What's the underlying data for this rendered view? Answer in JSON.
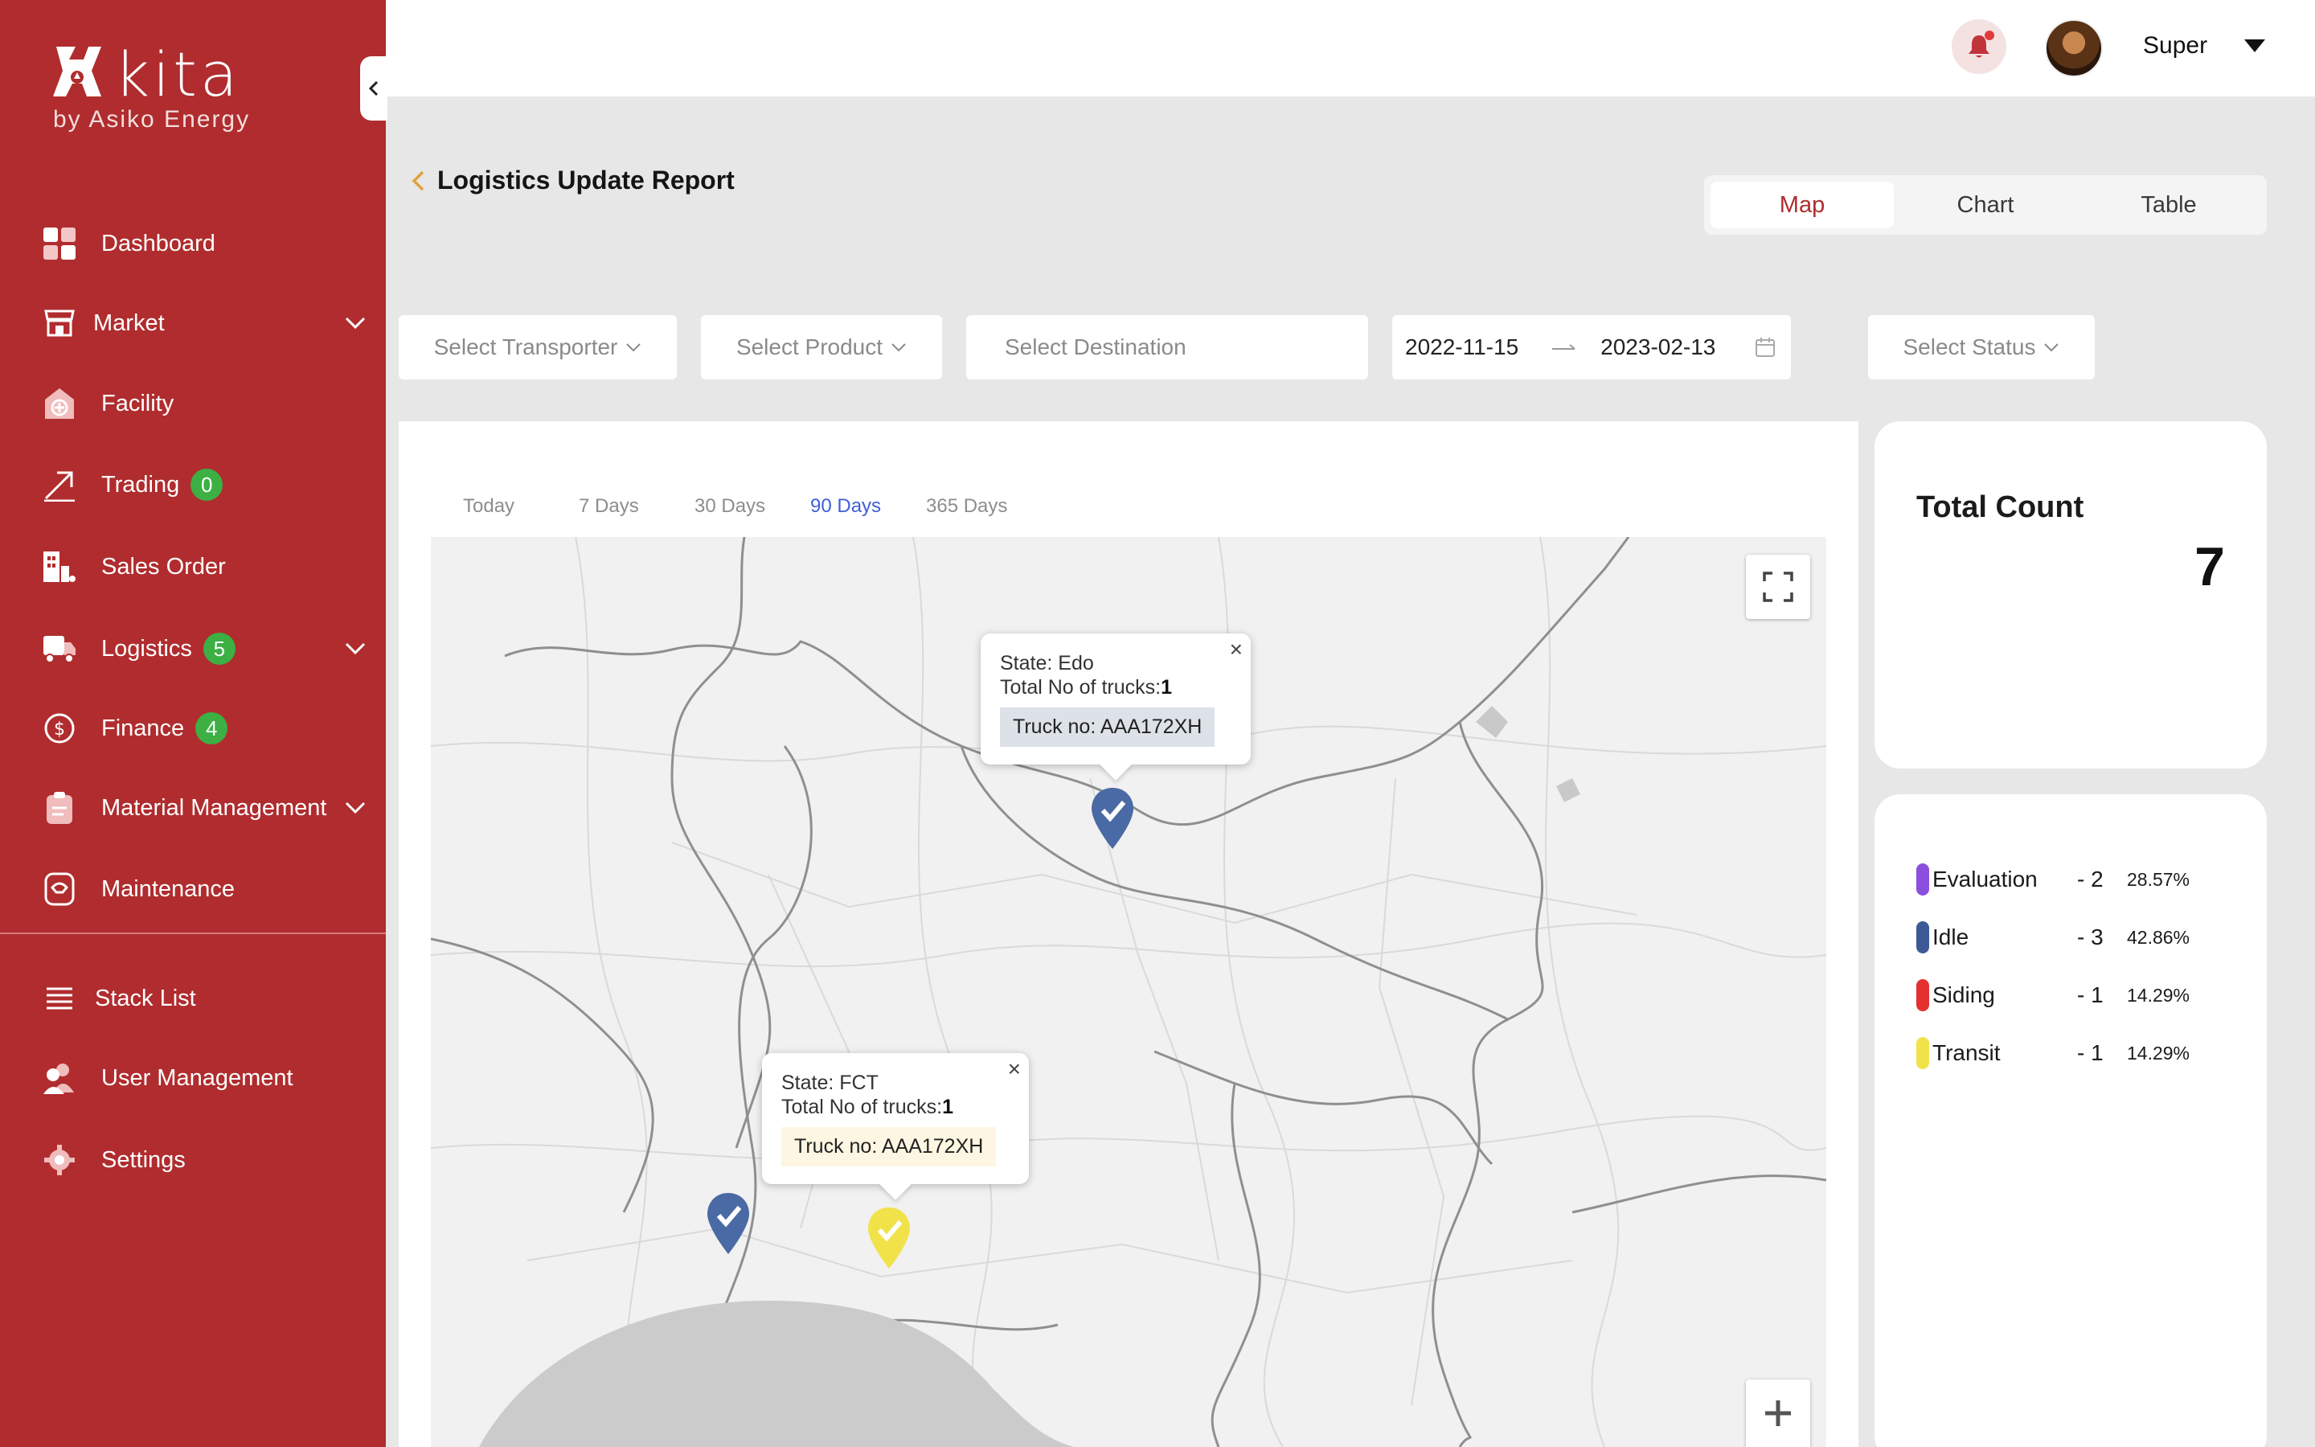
{
  "brand": {
    "name": "kita",
    "tagline": "by Asiko Energy"
  },
  "sidebar": {
    "items": [
      {
        "label": "Dashboard",
        "icon": "dashboard-icon"
      },
      {
        "label": "Market",
        "icon": "market-icon"
      },
      {
        "label": "Facility",
        "icon": "facility-icon"
      },
      {
        "label": "Trading",
        "icon": "trading-icon",
        "badge": "0"
      },
      {
        "label": "Sales Order",
        "icon": "sales-order-icon"
      },
      {
        "label": "Logistics",
        "icon": "truck-icon",
        "badge": "5"
      },
      {
        "label": "Finance",
        "icon": "dollar-icon",
        "badge": "4"
      },
      {
        "label": "Material Management",
        "icon": "clipboard-icon"
      },
      {
        "label": "Maintenance",
        "icon": "maintenance-icon"
      },
      {
        "label": "Stack List",
        "icon": "list-icon"
      },
      {
        "label": "User Management",
        "icon": "users-icon"
      },
      {
        "label": "Settings",
        "icon": "gear-icon"
      }
    ]
  },
  "topbar": {
    "user_name": "Super"
  },
  "header": {
    "title": "Logistics Update Report"
  },
  "view_tabs": [
    "Map",
    "Chart",
    "Table"
  ],
  "filters": {
    "transporter": "Select Transporter",
    "product": "Select Product",
    "destination": "Select Destination",
    "date_start": "2022-11-15",
    "date_end": "2023-02-13",
    "status": "Select Status"
  },
  "range_tabs": [
    "Today",
    "7 Days",
    "30 Days",
    "90 Days",
    "365 Days"
  ],
  "range_selected": "90 Days",
  "map": {
    "popups": [
      {
        "state": "State: Edo",
        "trucks_label": "Total No of trucks:",
        "trucks_value": "1",
        "truck_no": "Truck no: AAA172XH"
      },
      {
        "state": "State: FCT",
        "trucks_label": "Total No of trucks:",
        "trucks_value": "1",
        "truck_no": "Truck no: AAA172XH"
      }
    ],
    "close_glyph": "×",
    "zoom_in": "+"
  },
  "summary": {
    "title": "Total Count",
    "value": "7"
  },
  "legend": [
    {
      "name": "Evaluation",
      "count": "- 2",
      "percent": "28.57%",
      "color": "#8b4fe0"
    },
    {
      "name": "Idle",
      "count": "- 3",
      "percent": "42.86%",
      "color": "#3d5a97"
    },
    {
      "name": "Siding",
      "count": "- 1",
      "percent": "14.29%",
      "color": "#e53030"
    },
    {
      "name": "Transit",
      "count": "- 1",
      "percent": "14.29%",
      "color": "#f2e24a"
    }
  ],
  "colors": {
    "brand": "#b02c2e",
    "badge": "#3cb043",
    "active_range": "#3f5fd6",
    "pin_idle": "#4a6aa5",
    "pin_transit": "#f2e24a"
  }
}
